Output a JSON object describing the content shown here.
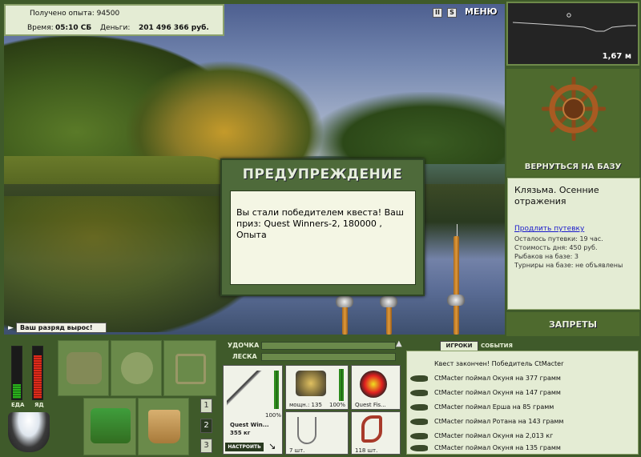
{
  "header": {
    "experience_label": "Получено опыта: 94500",
    "time_label": "Время:",
    "time_value": "05:10 СБ",
    "money_label": "Деньги:",
    "money_value": "201 496 366 руб."
  },
  "top_icons": {
    "pause": "II",
    "sound": "S",
    "menu": "МЕНЮ"
  },
  "dialog": {
    "title": "ПРЕДУПРЕЖДЕНИЕ",
    "message": "Вы стали победителем квеста! Ваш приз: Quest Winners-2, 180000 , Опыта"
  },
  "rank_message": "Ваш разряд вырос!",
  "depth": {
    "value": "1,67 м"
  },
  "return_base": "ВЕРНУТЬСЯ НА БАЗУ",
  "base": {
    "name": "Клязьма. Осенние отражения",
    "extend_link": "Продлить путевку",
    "info": [
      "Осталось путевки: 19 час.",
      "Стоимость дня: 450 руб.",
      "Рыбаков на базе: 3",
      "Турниры на базе: не объявлены"
    ]
  },
  "bans": "ЗАПРЕТЫ",
  "meters": {
    "food": "ЕДА",
    "poison": "ЯД"
  },
  "rod_bar": {
    "rod_label": "УДОЧКА",
    "line_label": "ЛЕСКА"
  },
  "tackle": {
    "rod_name": "Quest Win...",
    "rod_weight": "355 кг",
    "rod_percent": "100%",
    "setup_button": "НАСТРОИТЬ",
    "reel_label": "мощн.: 135",
    "reel_percent": "100%",
    "line_label": "Quest Fis...",
    "hook_count": "7 шт.",
    "bait_count": "118 шт."
  },
  "pages": [
    "1",
    "2",
    "3"
  ],
  "tabs": {
    "players": "ИГРОКИ",
    "events": "СОБЫТИЯ"
  },
  "events": [
    "Квест закончен! Победитель CtMacter",
    "CtMacter поймал Окуня на 377 грамм",
    "CtMacter поймал Окуня на 147 грамм",
    "CtMacter поймал Ерша на 85 грамм",
    "CtMacter поймал Ротана на 143 грамм",
    "CtMacter поймал Окуня на 2,013 кг",
    "CtMacter поймал Окуня на 135 грамм"
  ]
}
